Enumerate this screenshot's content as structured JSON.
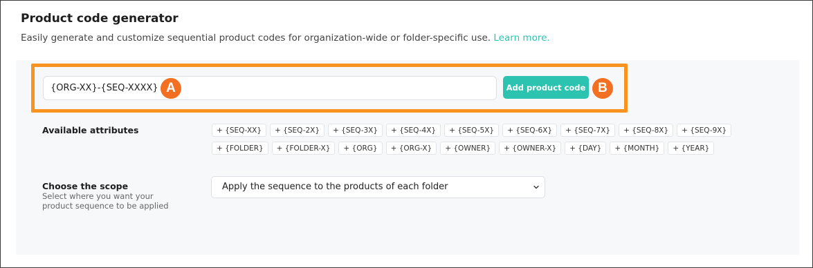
{
  "header": {
    "title": "Product code generator",
    "subtitle": "Easily generate and customize sequential product codes for organization-wide or folder-specific use.",
    "learn_more": "Learn more."
  },
  "code_input": {
    "value": "{ORG-XX}-{SEQ-XXXX}"
  },
  "add_button": {
    "label": "Add product code"
  },
  "badges": {
    "a": "A",
    "b": "B"
  },
  "attributes": {
    "label": "Available attributes",
    "rows": [
      [
        "+ {SEQ-XX}",
        "+ {SEQ-2X}",
        "+ {SEQ-3X}",
        "+ {SEQ-4X}",
        "+ {SEQ-5X}",
        "+ {SEQ-6X}",
        "+ {SEQ-7X}",
        "+ {SEQ-8X}",
        "+ {SEQ-9X}"
      ],
      [
        "+ {FOLDER}",
        "+ {FOLDER-X}",
        "+ {ORG}",
        "+ {ORG-X}",
        "+ {OWNER}",
        "+ {OWNER-X}",
        "+ {DAY}",
        "+ {MONTH}",
        "+ {YEAR}"
      ]
    ]
  },
  "scope": {
    "label": "Choose the scope",
    "help": "Select where you want your product sequence to be applied",
    "selected": "Apply the sequence to the products of each folder"
  },
  "colors": {
    "accent": "#2cc4b0",
    "highlight": "#f7931e",
    "badge": "#f36f21"
  }
}
